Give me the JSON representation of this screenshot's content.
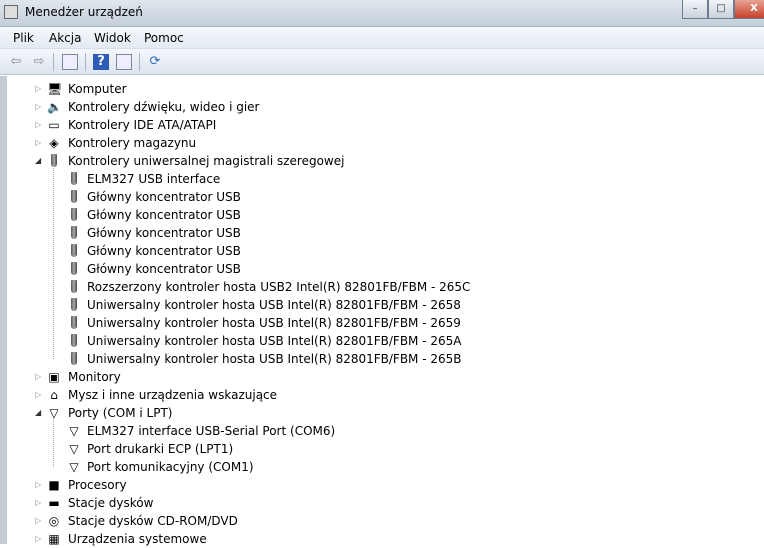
{
  "window": {
    "title": "Menedżer urządzeń",
    "minimize": "–",
    "maximize": "□",
    "close": "X"
  },
  "menu": [
    "Plik",
    "Akcja",
    "Widok",
    "Pomoc"
  ],
  "toolbar": {
    "back": "⇦",
    "forward": "⇨",
    "help": "?"
  },
  "tree": [
    {
      "label": "Komputer",
      "icon": "computer-icon",
      "expanded": false
    },
    {
      "label": "Kontrolery dźwięku, wideo i gier",
      "icon": "speaker-icon",
      "expanded": false
    },
    {
      "label": "Kontrolery IDE ATA/ATAPI",
      "icon": "ide-controller-icon",
      "expanded": false
    },
    {
      "label": "Kontrolery magazynu",
      "icon": "storage-controller-icon",
      "expanded": false
    },
    {
      "label": "Kontrolery uniwersalnej magistrali szeregowej",
      "icon": "usb-icon",
      "expanded": true,
      "children": [
        "ELM327 USB interface",
        "Główny koncentrator USB",
        "Główny koncentrator USB",
        "Główny koncentrator USB",
        "Główny koncentrator USB",
        "Główny koncentrator USB",
        "Rozszerzony kontroler hosta USB2 Intel(R) 82801FB/FBM - 265C",
        "Uniwersalny kontroler hosta USB Intel(R) 82801FB/FBM - 2658",
        "Uniwersalny kontroler hosta USB Intel(R) 82801FB/FBM - 2659",
        "Uniwersalny kontroler hosta USB Intel(R) 82801FB/FBM - 265A",
        "Uniwersalny kontroler hosta USB Intel(R) 82801FB/FBM - 265B"
      ]
    },
    {
      "label": "Monitory",
      "icon": "monitor-icon",
      "expanded": false
    },
    {
      "label": "Mysz i inne urządzenia wskazujące",
      "icon": "mouse-icon",
      "expanded": false
    },
    {
      "label": "Porty (COM i LPT)",
      "icon": "port-icon",
      "expanded": true,
      "children": [
        "ELM327 interface USB-Serial Port (COM6)",
        "Port drukarki ECP (LPT1)",
        "Port komunikacyjny (COM1)"
      ]
    },
    {
      "label": "Procesory",
      "icon": "processor-icon",
      "expanded": false
    },
    {
      "label": "Stacje dysków",
      "icon": "disk-drive-icon",
      "expanded": false
    },
    {
      "label": "Stacje dysków CD-ROM/DVD",
      "icon": "cdrom-icon",
      "expanded": false
    },
    {
      "label": "Urządzenia systemowe",
      "icon": "system-device-icon",
      "expanded": false
    }
  ]
}
